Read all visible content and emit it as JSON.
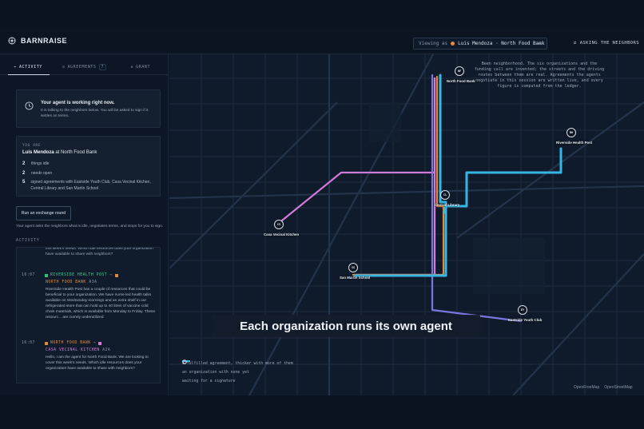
{
  "app": {
    "name": "BARNRAISE"
  },
  "header": {
    "viewing_label": "Viewing as",
    "viewing_user": "Luis Mendoza · North Food Bank",
    "asking_label": "ASKING THE NEIGHBORS"
  },
  "tabs": [
    {
      "label": "ACTIVITY"
    },
    {
      "label": "AGREEMENTS",
      "count": "7"
    },
    {
      "label": "GRANT"
    }
  ],
  "status_card": {
    "title": "Your agent is working right now.",
    "subtitle": "It is talking to the neighbors below. You will be asked to sign if it settles on terms."
  },
  "you_card": {
    "label": "YOU ARE",
    "name": "Luis Mendoza",
    "org_prefix": "at",
    "org": "North Food Bank",
    "stats": [
      {
        "n": "2",
        "text": "things idle"
      },
      {
        "n": "2",
        "text": "needs open"
      },
      {
        "n": "5",
        "text": "signed agreements with Eastside Youth Club, Casa Vecinal Kitchen, Central Library and San Martin School"
      }
    ]
  },
  "run_button": {
    "label": "Run an exchange round"
  },
  "run_hint": "Your agent asks the neighbors what is idle, negotiates terms, and stops for you to sign.",
  "activity": {
    "label": "ACTIVITY",
    "fragment": "this week's needs. Which idle resources does your organization have available to share with neighbors?",
    "messages": [
      {
        "time": "16:07",
        "from": "RIVERSIDE HEALTH POST",
        "to": "NORTH FOOD BANK",
        "to_code": "A3A",
        "body": "Riverside Health Post has a couple of resources that could be beneficial to your organization. We have nurse-led health talks available on Wednesday mornings and an extra shelf in our refrigerated store that can hold up to 40 litres of vaccine cold chain materials, which is available from Monday to Friday. These resourc... are currely underutilized"
      },
      {
        "time": "16:07",
        "from": "NORTH FOOD BANK",
        "to": "CASA VECINAL KITCHEN",
        "to_code": "A2A",
        "body": "Hello, I am the agent for North Food Bank. We are looking to cover this week's needs. Which idle resources does your organization have available to share with neighbors?"
      }
    ]
  },
  "map": {
    "blurb": "Been neighborhood. The six organizations and the funding call are invented; the streets and the driving routes between them are real. Agreements the agents negotiate in this session are written live, and every figure is computed from the ledger.",
    "caption": "Each organization runs its own agent",
    "legend": [
      "a fulfilled agreement, thicker with more of them",
      "an organization with none yet",
      "waiting for a signature"
    ],
    "attribution": [
      "OpenFreeMap",
      "OpenStreetMap"
    ],
    "nodes": [
      {
        "code": "NF",
        "name": "North Food Bank"
      },
      {
        "code": "RH",
        "name": "Riverside Health Post"
      },
      {
        "code": "CL",
        "name": "Central Library"
      },
      {
        "code": "CV",
        "name": "Casa Vecinal Kitchen"
      },
      {
        "code": "SS",
        "name": "San Martin School"
      },
      {
        "code": "EY",
        "name": "Eastside Youth Club"
      }
    ],
    "colors": {
      "fulfilled": "#35b6e6",
      "pink": "#d27ad8",
      "orange": "#e08a3c",
      "purple": "#7b75e0"
    }
  }
}
